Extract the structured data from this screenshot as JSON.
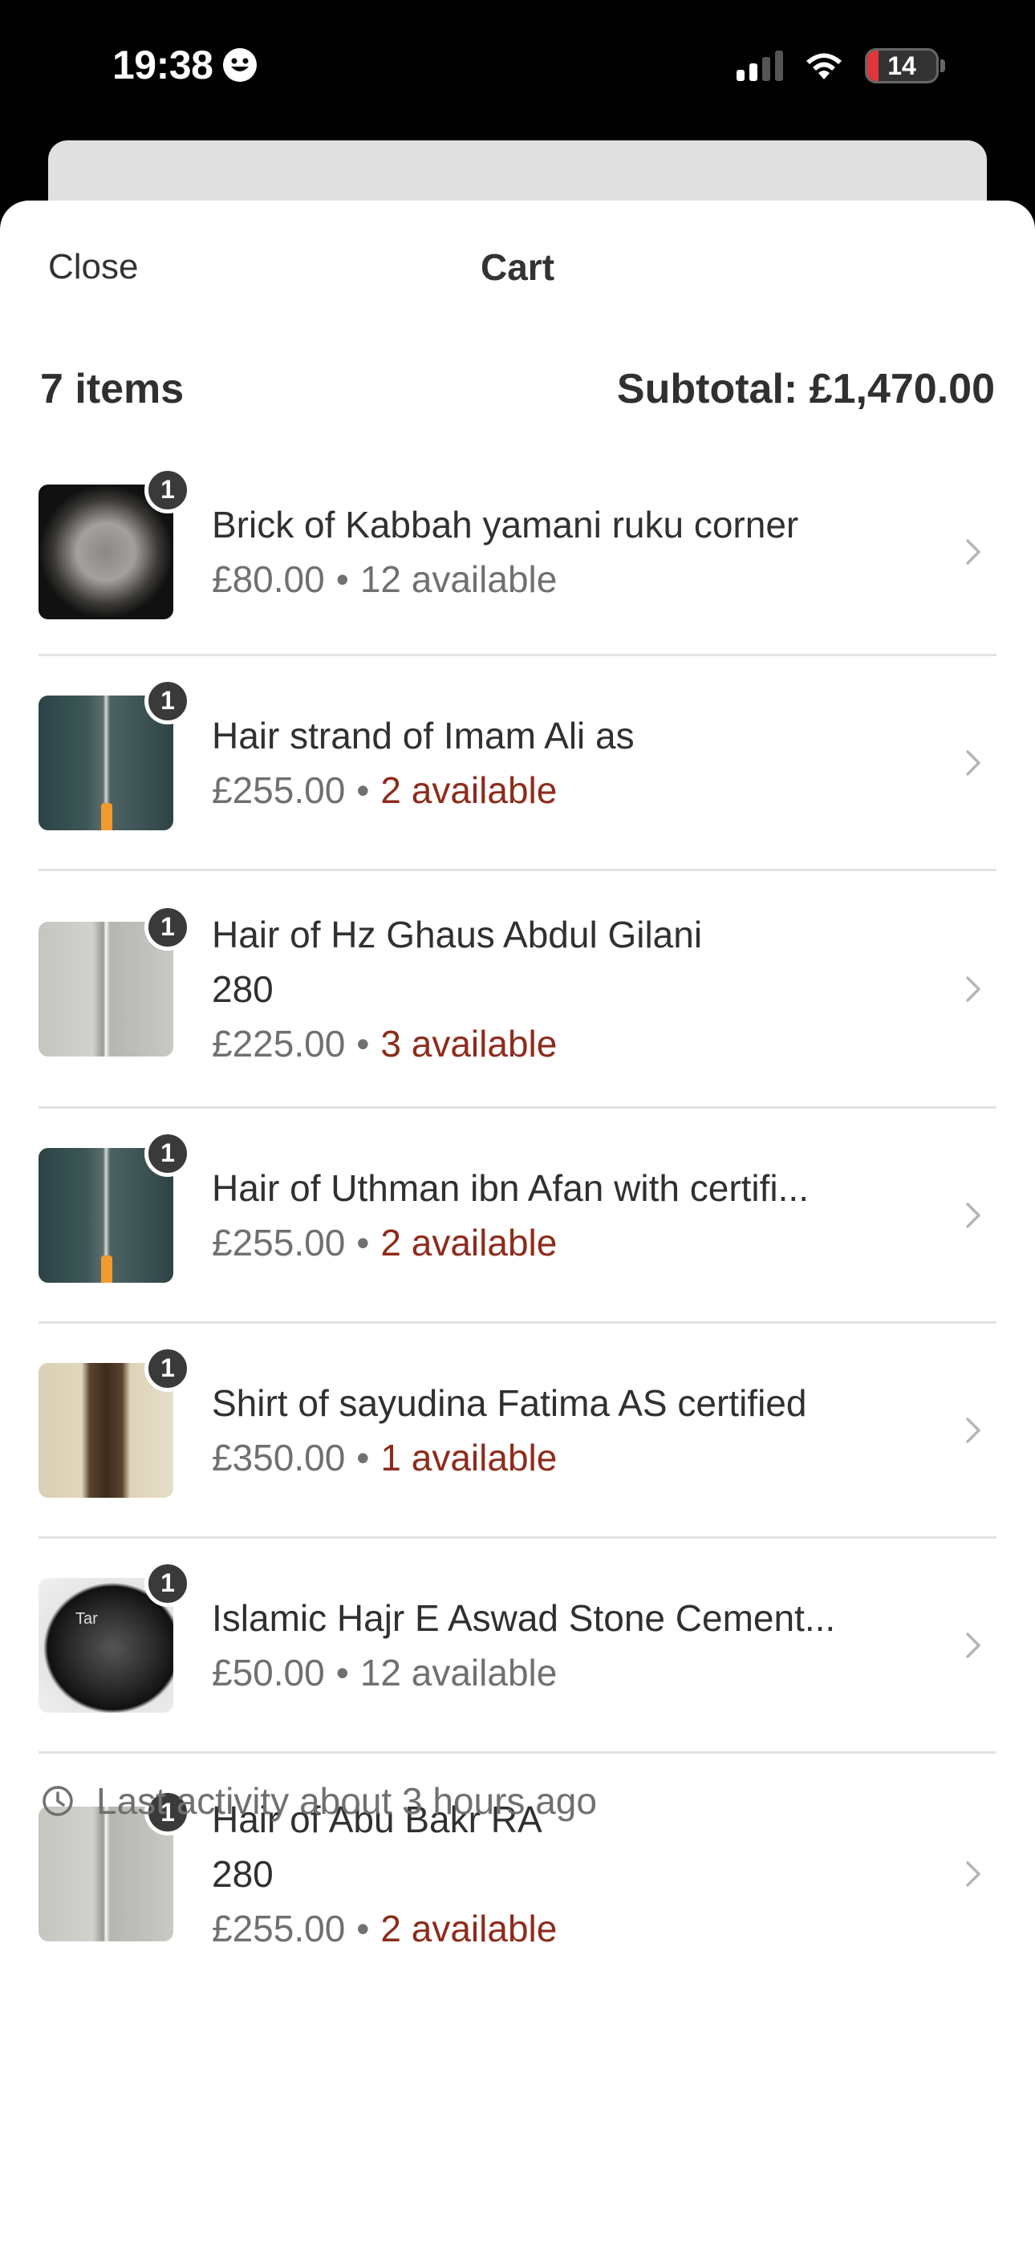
{
  "status_bar": {
    "time": "19:38",
    "battery": "14"
  },
  "nav": {
    "close_label": "Close",
    "title": "Cart"
  },
  "summary": {
    "count": "7 items",
    "subtotal": "Subtotal: £1,470.00"
  },
  "items": [
    {
      "qty": "1",
      "title": "Brick of Kabbah yamani ruku corner",
      "title2": "",
      "price": "£80.00",
      "availability": "12 available",
      "low_stock": false,
      "thumb": "t-brick"
    },
    {
      "qty": "1",
      "title": "Hair strand of Imam Ali as",
      "title2": "",
      "price": "£255.00",
      "availability": "2 available",
      "low_stock": true,
      "thumb": "t-glass-dark"
    },
    {
      "qty": "1",
      "title": "Hair of Hz Ghaus Abdul Gilani",
      "title2": "280",
      "price": "£225.00",
      "availability": "3 available",
      "low_stock": true,
      "thumb": "t-glass-light"
    },
    {
      "qty": "1",
      "title": "Hair of Uthman ibn Afan with certifi...",
      "title2": "",
      "price": "£255.00",
      "availability": "2 available",
      "low_stock": true,
      "thumb": "t-glass-dark"
    },
    {
      "qty": "1",
      "title": "Shirt of sayudina Fatima AS  certified",
      "title2": "",
      "price": "£350.00",
      "availability": "1 available",
      "low_stock": true,
      "thumb": "t-shirt"
    },
    {
      "qty": "1",
      "title": "Islamic Hajr  E Aswad Stone Cement...",
      "title2": "",
      "price": "£50.00",
      "availability": "12 available",
      "low_stock": false,
      "thumb": "t-stone",
      "thumb_label": "Tar"
    },
    {
      "qty": "1",
      "title": "Hair of Abu Bakr RA",
      "title2": "280",
      "price": "£255.00",
      "availability": "2 available",
      "low_stock": true,
      "thumb": "t-glass-light"
    }
  ],
  "separator": "•",
  "activity": {
    "text": "Last activity about 3 hours ago",
    "icon": "clock-icon"
  },
  "colors": {
    "low_stock": "#8e2b1b",
    "badge": "#3a3a3a",
    "battery_low": "#e0353b"
  }
}
